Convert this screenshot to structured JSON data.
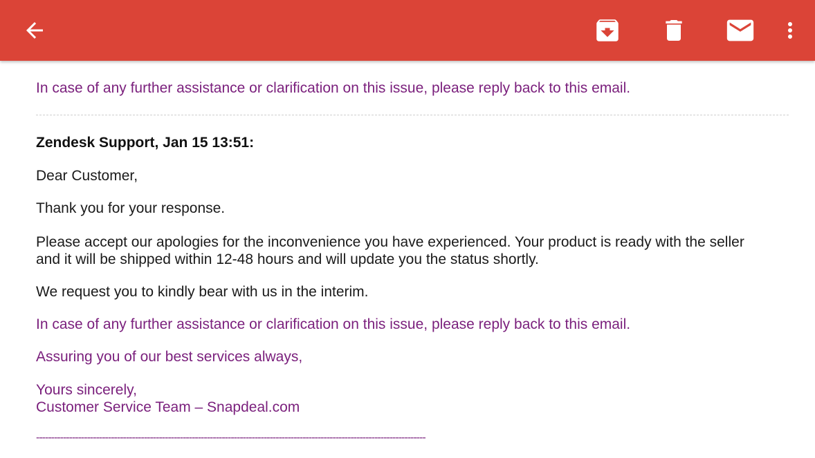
{
  "toolbar": {
    "background_color": "#db4437",
    "back_icon": "arrow-left-icon",
    "archive_icon": "archive-icon",
    "delete_icon": "trash-icon",
    "mark_unread_icon": "mail-icon",
    "more_icon": "more-vertical-icon"
  },
  "email": {
    "quoted_assistance_line": "In case of any further assistance or clarification on this issue, please reply back to this email.",
    "header": "Zendesk Support, Jan 15 13:51:",
    "greeting": "Dear Customer,",
    "thanks": "Thank you for your response.",
    "apology_line1": "Please accept our apologies for the inconvenience you have experienced. Your product is ready with the seller",
    "apology_line2": "and it will be shipped within 12-48 hours and will update you the status shortly.",
    "request": "We request you to kindly bear with us in the interim.",
    "assistance": "In case of any further assistance or clarification on this issue, please reply back to this email.",
    "assuring": "Assuring you of our best services always,",
    "sign_off": "Yours sincerely,",
    "signature": "Customer Service Team – Snapdeal.com",
    "separator": "----------------------------------------------------------------------------------------------------------------------------------"
  },
  "colors": {
    "accent_text": "#7a1f7c",
    "body_text": "#1a1a1a"
  }
}
